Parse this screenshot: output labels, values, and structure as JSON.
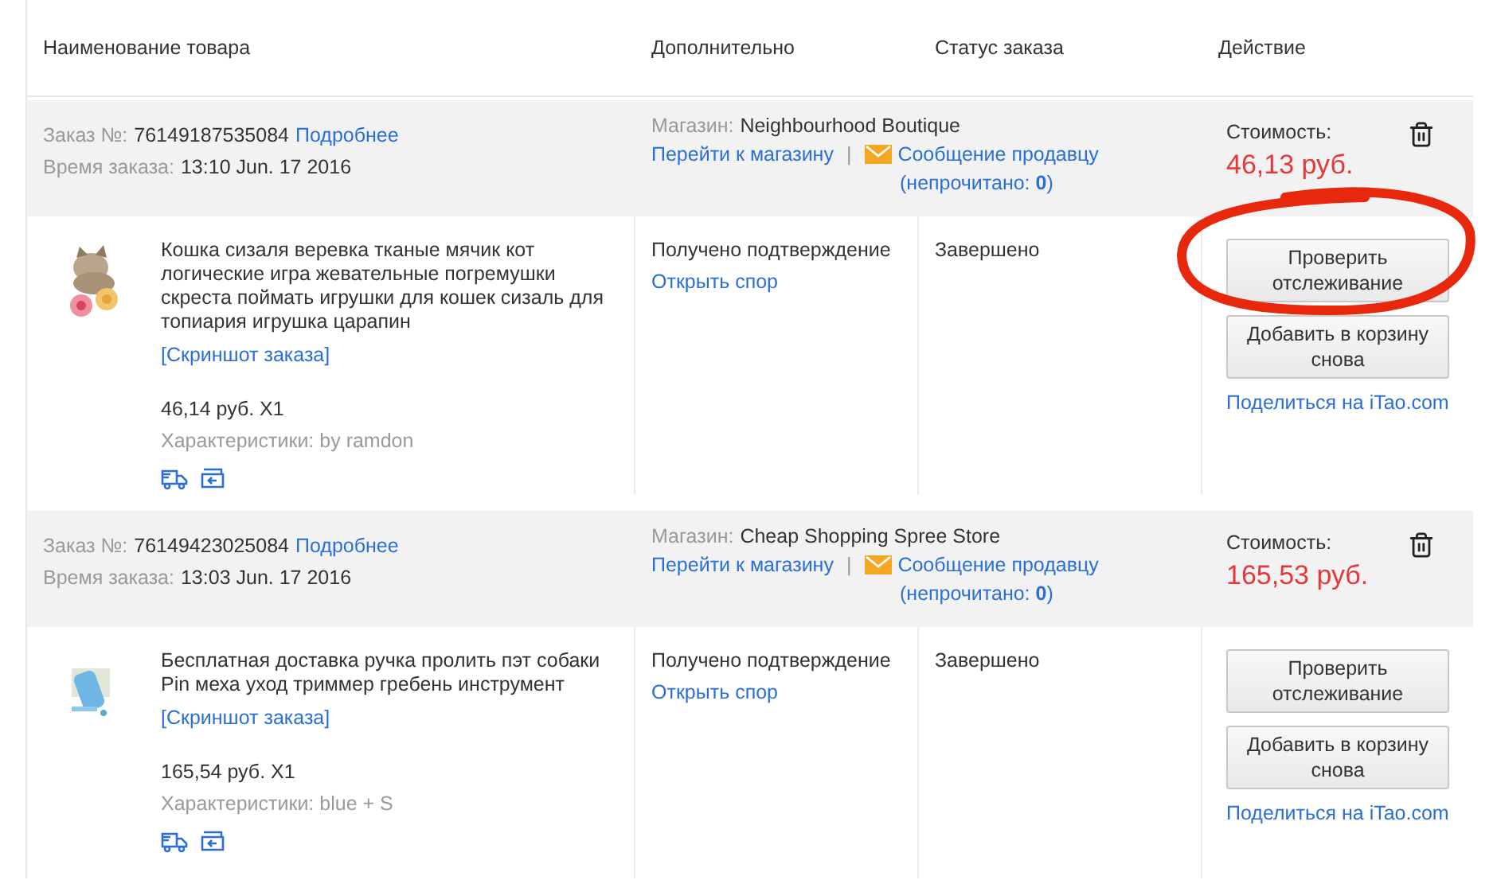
{
  "columns": [
    "Наименование товара",
    "Дополнительно",
    "Статус заказа",
    "Действие"
  ],
  "orders": [
    {
      "order_label": "Заказ №:",
      "order_number": "76149187535084",
      "details_link": "Подробнее",
      "time_label": "Время заказа:",
      "time": "13:10 Jun. 17 2016",
      "shop_label": "Магазин:",
      "shop": "Neighbourhood Boutique",
      "shop_link": "Перейти к магазину",
      "separator": "|",
      "message_link": "Сообщение продавцу",
      "unread": "(непрочитано: **0**)",
      "cost_label": "Стоимость:",
      "cost": "46,13 руб.",
      "item": {
        "title": "Кошка сизаля веревка тканые мячик кот логические игра жевательные погремушки скреста поймать игрушки для кошек сизаль для топиария игрушка царапин",
        "snapshot_link": "[Скриншот заказа]",
        "price": "46,14 руб. X1",
        "specs_label": "Характеристики:",
        "specs": "by ramdon",
        "confirmation": "Получено подтверждение",
        "dispute_link": "Открыть спор",
        "status": "Завершено",
        "track_button": "Проверить отслеживание",
        "track_circled": true,
        "reorder_button": "Добавить в корзину снова",
        "share_link": "Поделиться на iTao.com"
      }
    },
    {
      "order_label": "Заказ №:",
      "order_number": "76149423025084",
      "details_link": "Подробнее",
      "time_label": "Время заказа:",
      "time": "13:03 Jun. 17 2016",
      "shop_label": "Магазин:",
      "shop": "Cheap Shopping Spree Store",
      "shop_link": "Перейти к магазину",
      "separator": "|",
      "message_link": "Сообщение продавцу",
      "unread": "(непрочитано: **0**)",
      "cost_label": "Стоимость:",
      "cost": "165,53 руб.",
      "item": {
        "title": "Бесплатная доставка ручка пролить пэт собаки Pin меха уход триммер гребень инструмент",
        "snapshot_link": "[Скриншот заказа]",
        "price": "165,54 руб. X1",
        "specs_label": "Характеристики:",
        "specs": "blue + S",
        "confirmation": "Получено подтверждение",
        "dispute_link": "Открыть спор",
        "status": "Завершено",
        "track_button": "Проверить отслеживание",
        "track_circled": false,
        "reorder_button": "Добавить в корзину снова",
        "share_link": "Поделиться на iTao.com"
      }
    }
  ]
}
